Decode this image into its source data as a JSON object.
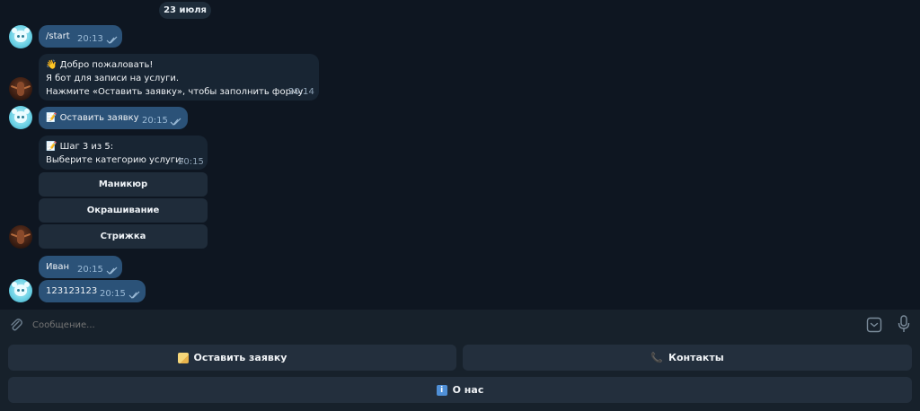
{
  "chat": {
    "date": "23 июля",
    "messages": {
      "m1": {
        "text": "/start",
        "time": "20:13"
      },
      "m2": {
        "lines": [
          "👋 Добро пожаловать!",
          "Я бот для записи на услуги.",
          "Нажмите «Оставить заявку», чтобы заполнить форму."
        ],
        "time": "20:14"
      },
      "m3": {
        "text": "📝 Оставить заявку",
        "time": "20:15"
      },
      "m4": {
        "lines": [
          "📝 Шаг 3 из 5:",
          "Выберите категорию услуги:"
        ],
        "time": "20:15",
        "buttons": [
          "Маникюр",
          "Окрашивание",
          "Стрижка"
        ]
      },
      "m5": {
        "text": "Иван",
        "time": "20:15"
      },
      "m6": {
        "text": "123123123",
        "time": "20:15"
      }
    }
  },
  "composer": {
    "placeholder": "Сообщение...",
    "icons": [
      "paperclip-icon",
      "keyboard-toggle-icon",
      "microphone-icon"
    ]
  },
  "keyboard": {
    "leave_request": "Оставить заявку",
    "contacts": "Контакты",
    "about": "О нас"
  },
  "colors": {
    "background": "#0e1621",
    "incoming_bubble": "#182533",
    "outgoing_bubble": "#2b5278",
    "composer": "#17212b",
    "keyboard_button": "#232f3d"
  }
}
